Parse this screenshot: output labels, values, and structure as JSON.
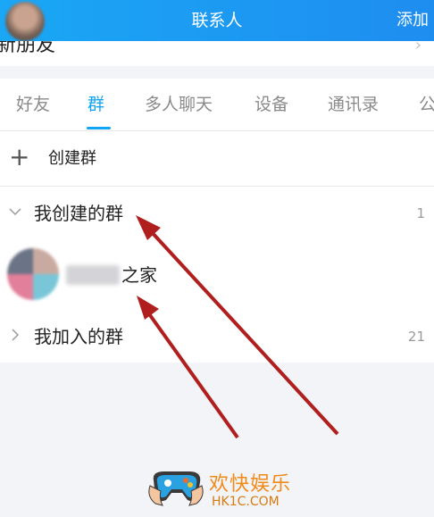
{
  "header": {
    "title": "联系人",
    "add_label": "添加"
  },
  "new_friends": {
    "label": "新朋友"
  },
  "tabs": [
    {
      "label": "好友",
      "active": false
    },
    {
      "label": "群",
      "active": true
    },
    {
      "label": "多人聊天",
      "active": false
    },
    {
      "label": "设备",
      "active": false
    },
    {
      "label": "通讯录",
      "active": false
    },
    {
      "label": "公",
      "active": false
    }
  ],
  "create_group": {
    "label": "创建群"
  },
  "groups": {
    "created": {
      "label": "我创建的群",
      "count": "1",
      "expanded": true
    },
    "created_item": {
      "name_visible": "之家"
    },
    "joined": {
      "label": "我加入的群",
      "count": "21",
      "expanded": false
    }
  },
  "watermark": {
    "title": "欢快娱乐",
    "site": "HK1C.COM"
  },
  "colors": {
    "accent": "#12a4f5",
    "header": "#1aa7f5",
    "arrow": "#b01e1e",
    "watermark": "#f08a18"
  }
}
